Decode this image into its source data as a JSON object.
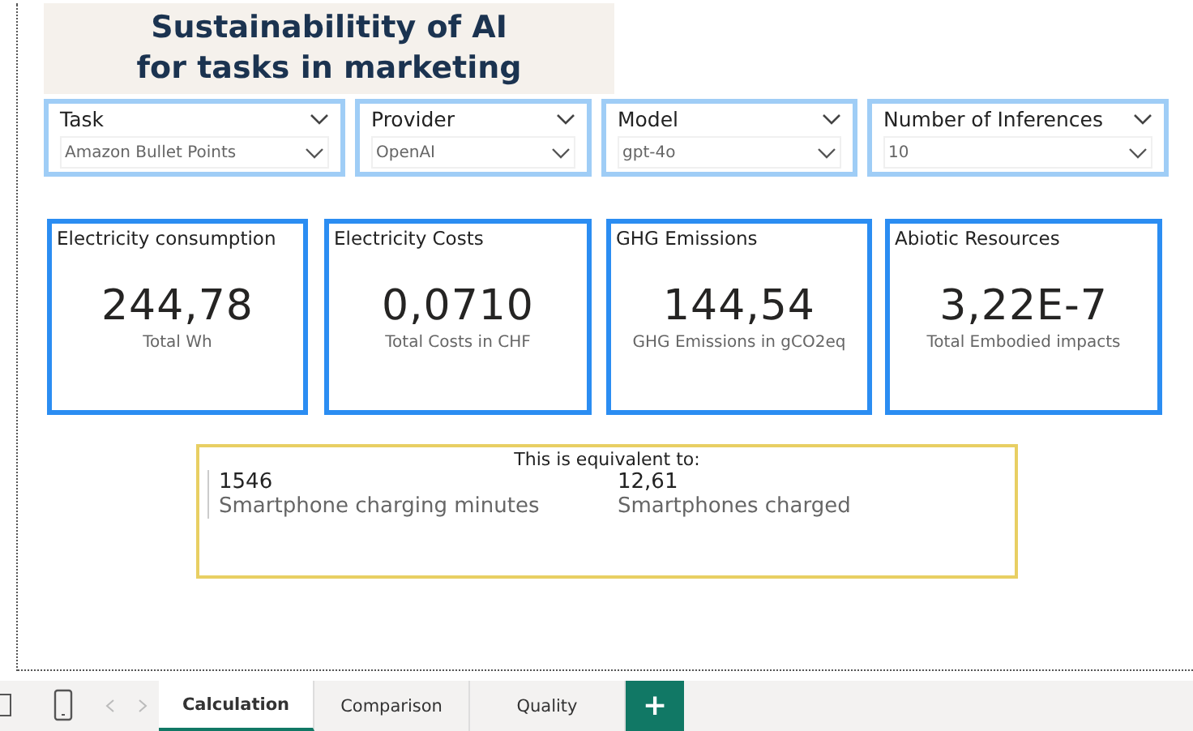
{
  "title": [
    "Sustainabilitity of AI",
    "for tasks in marketing"
  ],
  "slicers": [
    {
      "label": "Task",
      "value": "Amazon Bullet Points"
    },
    {
      "label": "Provider",
      "value": "OpenAI"
    },
    {
      "label": "Model",
      "value": "gpt-4o"
    },
    {
      "label": "Number of Inferences",
      "value": "10"
    }
  ],
  "cards": [
    {
      "title": "Electricity consumption",
      "value": "244,78",
      "caption": "Total Wh"
    },
    {
      "title": "Electricity Costs",
      "value": "0,0710",
      "caption": "Total Costs in CHF"
    },
    {
      "title": "GHG Emissions",
      "value": "144,54",
      "caption": "GHG Emissions in gCO2eq"
    },
    {
      "title": "Abiotic Resources",
      "value": "3,22E-7",
      "caption": "Total Embodied impacts"
    }
  ],
  "equivalent": {
    "heading": "This is equivalent to:",
    "items": [
      {
        "value": "1546",
        "label": "Smartphone charging minutes"
      },
      {
        "value": "12,61",
        "label": "Smartphones charged"
      }
    ]
  },
  "tabs": [
    {
      "label": "Calculation",
      "selected": true
    },
    {
      "label": "Comparison",
      "selected": false
    },
    {
      "label": "Quality",
      "selected": false
    }
  ],
  "add_tab": "+"
}
